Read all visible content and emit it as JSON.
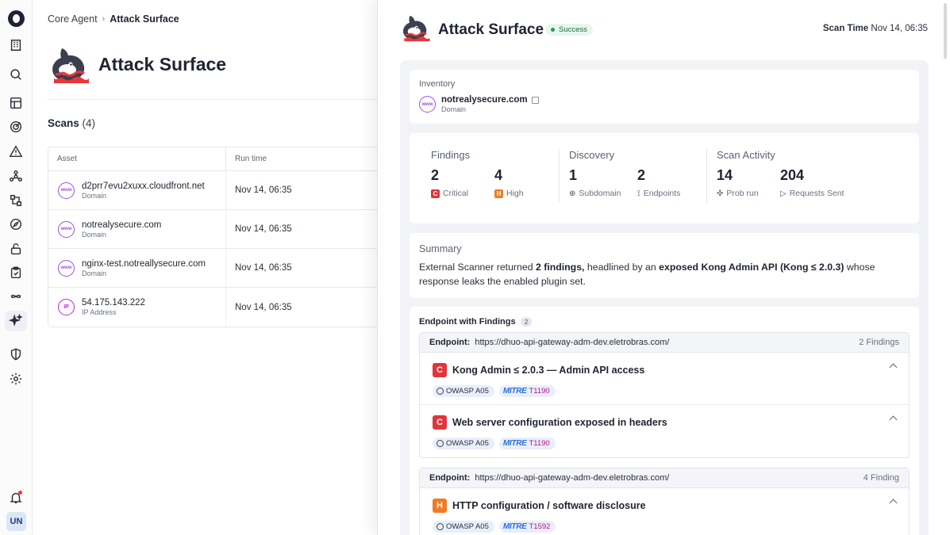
{
  "rail": {
    "avatar_initials": "UN",
    "icons": [
      "app-logo-icon",
      "building-icon",
      "search-icon",
      "layout-icon",
      "target-icon",
      "alert-icon",
      "network-icon",
      "workflow-icon",
      "compass-icon",
      "lock-icon",
      "clipboard-icon",
      "infinity-icon",
      "sparkles-icon",
      "shield-icon",
      "settings-icon",
      "bell-icon"
    ]
  },
  "background_page": {
    "breadcrumb": {
      "parent": "Core Agent",
      "separator": "›",
      "current": "Attack Surface"
    },
    "title": "Attack Surface",
    "scans": {
      "label": "Scans",
      "count": "(4)"
    },
    "table": {
      "headers": [
        "Asset",
        "Run time"
      ],
      "rows": [
        {
          "name": "d2prr7evu2xuxx.cloudfront.net",
          "type": "Domain",
          "icon": "www",
          "run_time": "Nov 14, 06:35"
        },
        {
          "name": "notrealysecure.com",
          "type": "Domain",
          "icon": "www",
          "run_time": "Nov 14, 06:35"
        },
        {
          "name": "nginx-test.notreallysecure.com",
          "type": "Domain",
          "icon": "www",
          "run_time": "Nov 14, 06:35"
        },
        {
          "name": "54.175.143.222",
          "type": "IP Address",
          "icon": "IP",
          "run_time": "Nov 14, 06:35"
        }
      ]
    }
  },
  "drawer": {
    "title": "Attack Surface",
    "status": "Success",
    "scan_time_label": "Scan Time",
    "scan_time_value": "Nov 14, 06:35",
    "inventory": {
      "label": "Inventory",
      "icon_text": "www",
      "name": "notrealysecure.com",
      "type": "Domain"
    },
    "stats": {
      "findings": {
        "title": "Findings",
        "critical": {
          "value": "2",
          "label": "Critical",
          "badge": "C"
        },
        "high": {
          "value": "4",
          "label": "High",
          "badge": "H"
        }
      },
      "discovery": {
        "title": "Discovery",
        "subdomain": {
          "value": "1",
          "label": "Subdomain"
        },
        "endpoints": {
          "value": "2",
          "label": "Endpoints"
        }
      },
      "scan_activity": {
        "title": "Scan Activity",
        "prob_run": {
          "value": "14",
          "label": "Prob run"
        },
        "requests": {
          "value": "204",
          "label": "Requests Sent"
        }
      }
    },
    "summary": {
      "label": "Summary",
      "t1": "External Scanner returned ",
      "b1": "2 findings,",
      "t2": " headlined by an ",
      "b2": "exposed Kong Admin API (Kong ≤ 2.0.3)",
      "t3": " whose response leaks the enabled plugin set."
    },
    "endpoints": {
      "heading": "Endpoint with Findings",
      "count": "2",
      "groups": [
        {
          "label": "Endpoint:",
          "url": "https://dhuo-api-gateway-adm-dev.eletrobras.com/",
          "count_text": "2 Findings",
          "findings": [
            {
              "severity": "C",
              "title": "Kong Admin ≤ 2.0.3 — Admin API access",
              "owasp": "OWASP A05",
              "mitre_brand": "MITRE",
              "mitre_id": "T1190"
            },
            {
              "severity": "C",
              "title": "Web server configuration exposed in headers",
              "owasp": "OWASP A05",
              "mitre_brand": "MITRE",
              "mitre_id": "T1190"
            }
          ]
        },
        {
          "label": "Endpoint:",
          "url": "https://dhuo-api-gateway-adm-dev.eletrobras.com/",
          "count_text": "4 Finding",
          "findings": [
            {
              "severity": "H",
              "title": "HTTP configuration / software disclosure",
              "owasp": "OWASP A05",
              "mitre_brand": "MITRE",
              "mitre_id": "T1592"
            }
          ]
        }
      ]
    }
  },
  "colors": {
    "critical": "#e0353a",
    "high": "#ee7b25",
    "success": "#17a35c",
    "accent_purple": "#9b51e0",
    "mitre_blue": "#2b6fd6"
  }
}
